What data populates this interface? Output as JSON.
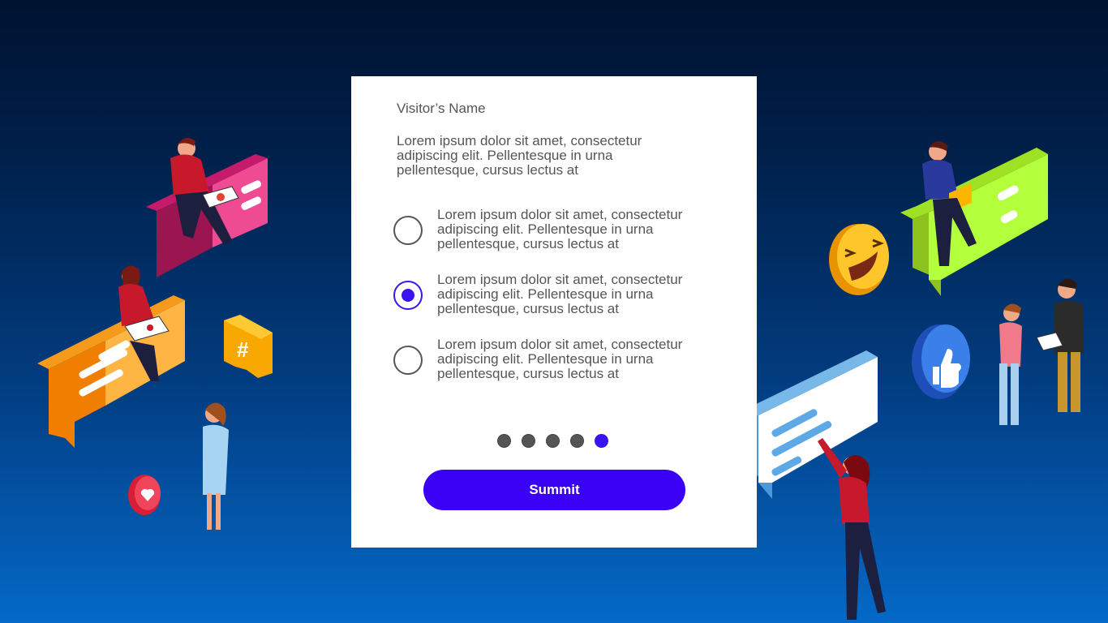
{
  "form": {
    "title": "Visitor’s Name",
    "description": "Lorem ipsum dolor sit amet, consectetur adipiscing elit. Pellentesque in urna pellentesque, cursus lectus at",
    "options": [
      {
        "label": "Lorem ipsum dolor sit amet, consectetur adipiscing elit. Pellentesque in urna pellentesque, cursus lectus at",
        "selected": false
      },
      {
        "label": "Lorem ipsum dolor sit amet, consectetur adipiscing elit. Pellentesque in urna pellentesque, cursus lectus at",
        "selected": true
      },
      {
        "label": "Lorem ipsum dolor sit amet, consectetur adipiscing elit. Pellentesque in urna pellentesque, cursus lectus at",
        "selected": false
      }
    ],
    "pagination": {
      "total": 5,
      "current": 5
    },
    "submit_label": "Summit"
  },
  "colors": {
    "accent": "#3a00f5",
    "text": "#555555",
    "background_top": "#001331",
    "background_bottom": "#0469c8"
  },
  "decorations": {
    "icons": [
      "pink-chat-bubble-icon",
      "orange-chat-bubble-icon",
      "hashtag-icon",
      "heart-icon",
      "laughing-emoji-icon",
      "green-chat-bubble-icon",
      "thumbs-up-icon",
      "blue-chat-bubble-icon"
    ]
  }
}
